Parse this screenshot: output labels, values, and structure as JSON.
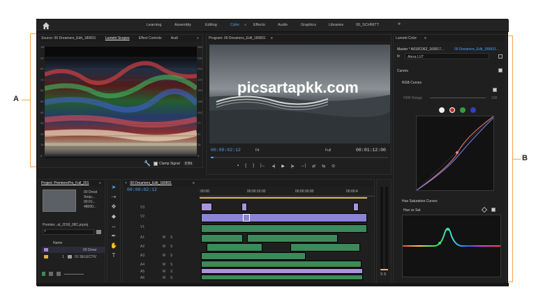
{
  "app": {
    "workspaces": [
      {
        "label": "Learning",
        "active": false
      },
      {
        "label": "Assembly",
        "active": false
      },
      {
        "label": "Editing",
        "active": false
      },
      {
        "label": "Color",
        "active": true
      },
      {
        "label": "Effects",
        "active": false
      },
      {
        "label": "Audio",
        "active": false
      },
      {
        "label": "Graphics",
        "active": false
      },
      {
        "label": "Libraries",
        "active": false
      },
      {
        "label": "00_SCHNITT",
        "active": false
      }
    ],
    "workspace_more": "»",
    "color_tab_menu": "≡"
  },
  "source_panel": {
    "tabs": [
      "Source: 00 Dreamers_Edit_180831",
      "Lumetri Scopes",
      "Effect Controls",
      "Audi"
    ],
    "active_tab": "Lumetri Scopes",
    "more": "»",
    "scale_left": [
      "100",
      "90",
      "80",
      "70",
      "60",
      "50",
      "40",
      "30",
      "20",
      "10",
      "0"
    ],
    "scale_right": [
      "255",
      "230",
      "204",
      "179",
      "153",
      "128",
      "102",
      "77",
      "51",
      "26",
      "0"
    ],
    "clamp_label": "Clamp Signal",
    "bit_depth": "8 Bit"
  },
  "program_panel": {
    "title": "Program: 00 Dreamers_Edit_180831",
    "menu": "≡",
    "timecode_left": "00:00:02:12",
    "fit": "Fit",
    "full": "Full",
    "timecode_right": "00:01:12:00",
    "transport": [
      "▪",
      "{",
      "}",
      "|←",
      "◂|",
      "▶",
      "|▸",
      "→|",
      "⇄",
      "⇆",
      "⊙"
    ]
  },
  "project_panel": {
    "title": "Project: PremierePro_Full_201",
    "more": "»",
    "item_name": "00 Dreat",
    "item_lines": [
      "Sequ...",
      "00:01...",
      "48000..."
    ],
    "file_name": "Premier...al_2018_08C.prproj",
    "column_name": "Name",
    "rows": [
      "00 Drear",
      "01 SELECTIV"
    ],
    "row2_index": "1"
  },
  "timeline": {
    "title": "00 Dreamers_Edit_180831",
    "close": "×",
    "menu": "≡",
    "timecode": "00:00:02:12",
    "ruler": [
      ":00:00",
      "00:00:15:00",
      "00:00:30:00",
      "00:00:4"
    ],
    "tracks": [
      "V3",
      "V2",
      "V1",
      "A1",
      "A2",
      "A3",
      "A4",
      "A5",
      "A6"
    ],
    "track_mute": "M",
    "track_solo": "S",
    "meter_label": "S S"
  },
  "lumetri": {
    "title": "Lumetri Color",
    "menu": "≡",
    "master": "Master * A010C062_160517...",
    "target": "00 Dreamers_Edit_180831...",
    "fx": "fx",
    "lut": "Alexa LUT",
    "curves": "Curves",
    "rgb_curves": "RGB Curves",
    "hdr_range": "HDR Range",
    "hdr_value": "100",
    "hue_sat_curves": "Hue Saturation Curves",
    "hue_vs_sat": "Hue vs Sat"
  },
  "annotations": {
    "left_label": "A",
    "right_label": "B",
    "bracket_color": "#f0a24a"
  },
  "watermark": "picsartapkk.com"
}
